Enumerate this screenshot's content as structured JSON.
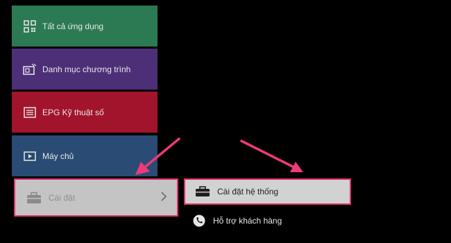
{
  "menu": {
    "items": [
      {
        "label": "Tất cả ứng dụng",
        "icon": "apps-grid-icon",
        "color": "#2c7a53"
      },
      {
        "label": "Danh mục chương trình",
        "icon": "tv-list-icon",
        "color": "#4d2f78"
      },
      {
        "label": "EPG Kỹ thuật số",
        "icon": "epg-guide-icon",
        "color": "#a1142b"
      },
      {
        "label": "Máy chủ",
        "icon": "media-server-icon",
        "color": "#2a4b73"
      },
      {
        "label": "Cài đặt",
        "icon": "toolbox-icon",
        "color": "#c4c4c4",
        "selected": true
      }
    ]
  },
  "submenu": {
    "items": [
      {
        "label": "Cài đặt hệ thống",
        "icon": "toolbox-icon",
        "highlighted": true
      },
      {
        "label": "Hỗ trợ khách hàng",
        "icon": "phone-icon"
      }
    ]
  },
  "theme": {
    "background": "#000000",
    "highlight_border": "#e0306e",
    "annotation_arrow": "#ee3a7a"
  }
}
